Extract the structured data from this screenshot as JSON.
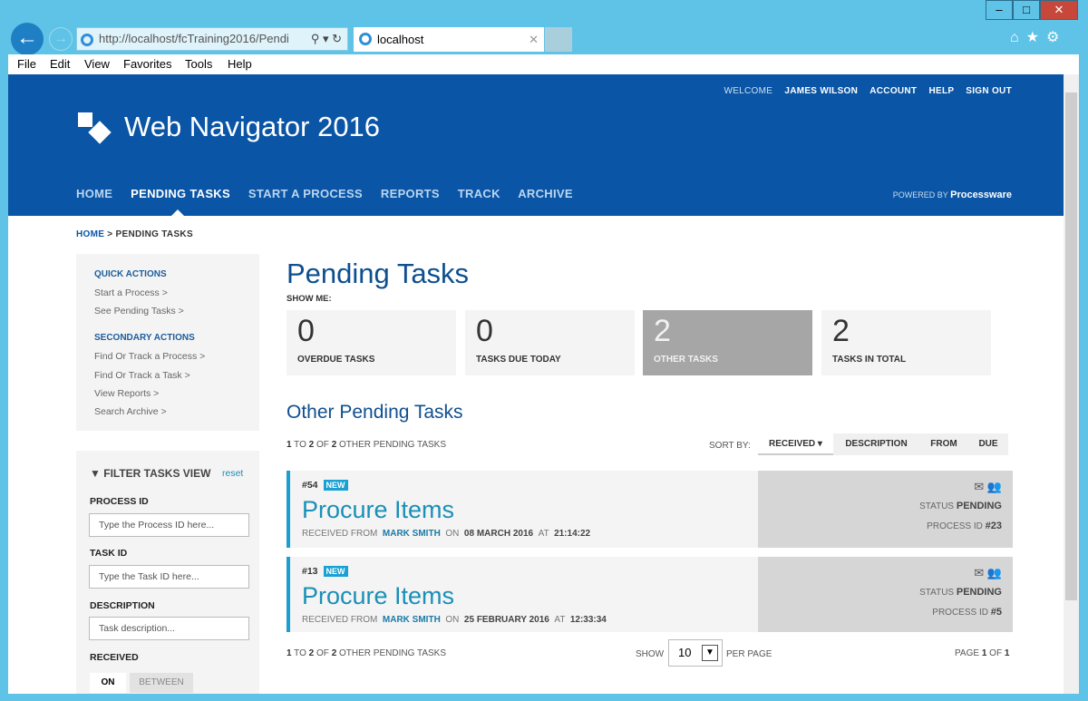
{
  "browser": {
    "url": "http://localhost/fcTraining2016/Pendi",
    "tab_title": "localhost",
    "menu": [
      "File",
      "Edit",
      "View",
      "Favorites",
      "Tools",
      "Help"
    ]
  },
  "header": {
    "welcome": "WELCOME",
    "user": "JAMES WILSON",
    "account": "ACCOUNT",
    "help": "HELP",
    "signout": "SIGN OUT",
    "app_title": "Web Navigator 2016",
    "powered_by": "POWERED BY",
    "brand": "Processware",
    "nav": [
      "HOME",
      "PENDING TASKS",
      "START A PROCESS",
      "REPORTS",
      "TRACK",
      "ARCHIVE"
    ]
  },
  "breadcrumb": {
    "home": "HOME",
    "sep": ">",
    "current": "PENDING TASKS"
  },
  "sidebar": {
    "quick_title": "QUICK ACTIONS",
    "quick": [
      "Start a Process >",
      "See Pending Tasks >"
    ],
    "secondary_title": "SECONDARY ACTIONS",
    "secondary": [
      "Find Or Track a Process >",
      "Find Or Track a Task >",
      "View Reports >",
      "Search Archive >"
    ],
    "filter": {
      "title": "FILTER TASKS VIEW",
      "reset": "reset",
      "process_label": "PROCESS ID",
      "process_ph": "Type the Process ID here...",
      "task_label": "TASK ID",
      "task_ph": "Type the Task ID here...",
      "desc_label": "DESCRIPTION",
      "desc_ph": "Task description...",
      "received_label": "RECEIVED",
      "on": "ON",
      "between": "BETWEEN"
    }
  },
  "main": {
    "title": "Pending Tasks",
    "show_me": "SHOW ME:",
    "cards": [
      {
        "n": "0",
        "label": "OVERDUE TASKS"
      },
      {
        "n": "0",
        "label": "TASKS DUE TODAY"
      },
      {
        "n": "2",
        "label": "OTHER TASKS"
      },
      {
        "n": "2",
        "label": "TASKS IN TOTAL"
      }
    ],
    "section_title": "Other Pending Tasks",
    "count": {
      "from": "1",
      "to_word": "TO",
      "to": "2",
      "of_word": "OF",
      "total": "2",
      "suffix": "OTHER PENDING TASKS"
    },
    "sort": {
      "label": "SORT BY:",
      "options": [
        "RECEIVED ▾",
        "DESCRIPTION",
        "FROM",
        "DUE"
      ]
    },
    "tasks": [
      {
        "id": "#54",
        "badge": "NEW",
        "name": "Procure Items",
        "received_from": "RECEIVED FROM",
        "from": "MARK SMITH",
        "on": "ON",
        "date": "08 MARCH 2016",
        "at": "AT",
        "time": "21:14:22",
        "status_label": "STATUS",
        "status": "PENDING",
        "process_label": "PROCESS ID",
        "process": "#23"
      },
      {
        "id": "#13",
        "badge": "NEW",
        "name": "Procure Items",
        "received_from": "RECEIVED FROM",
        "from": "MARK SMITH",
        "on": "ON",
        "date": "25 FEBRUARY 2016",
        "at": "AT",
        "time": "12:33:34",
        "status_label": "STATUS",
        "status": "PENDING",
        "process_label": "PROCESS ID",
        "process": "#5"
      }
    ],
    "footer": {
      "show": "SHOW",
      "per_page_value": "10",
      "per_page": "PER PAGE",
      "page_word": "PAGE",
      "page": "1",
      "of_word": "OF",
      "pages": "1"
    }
  }
}
